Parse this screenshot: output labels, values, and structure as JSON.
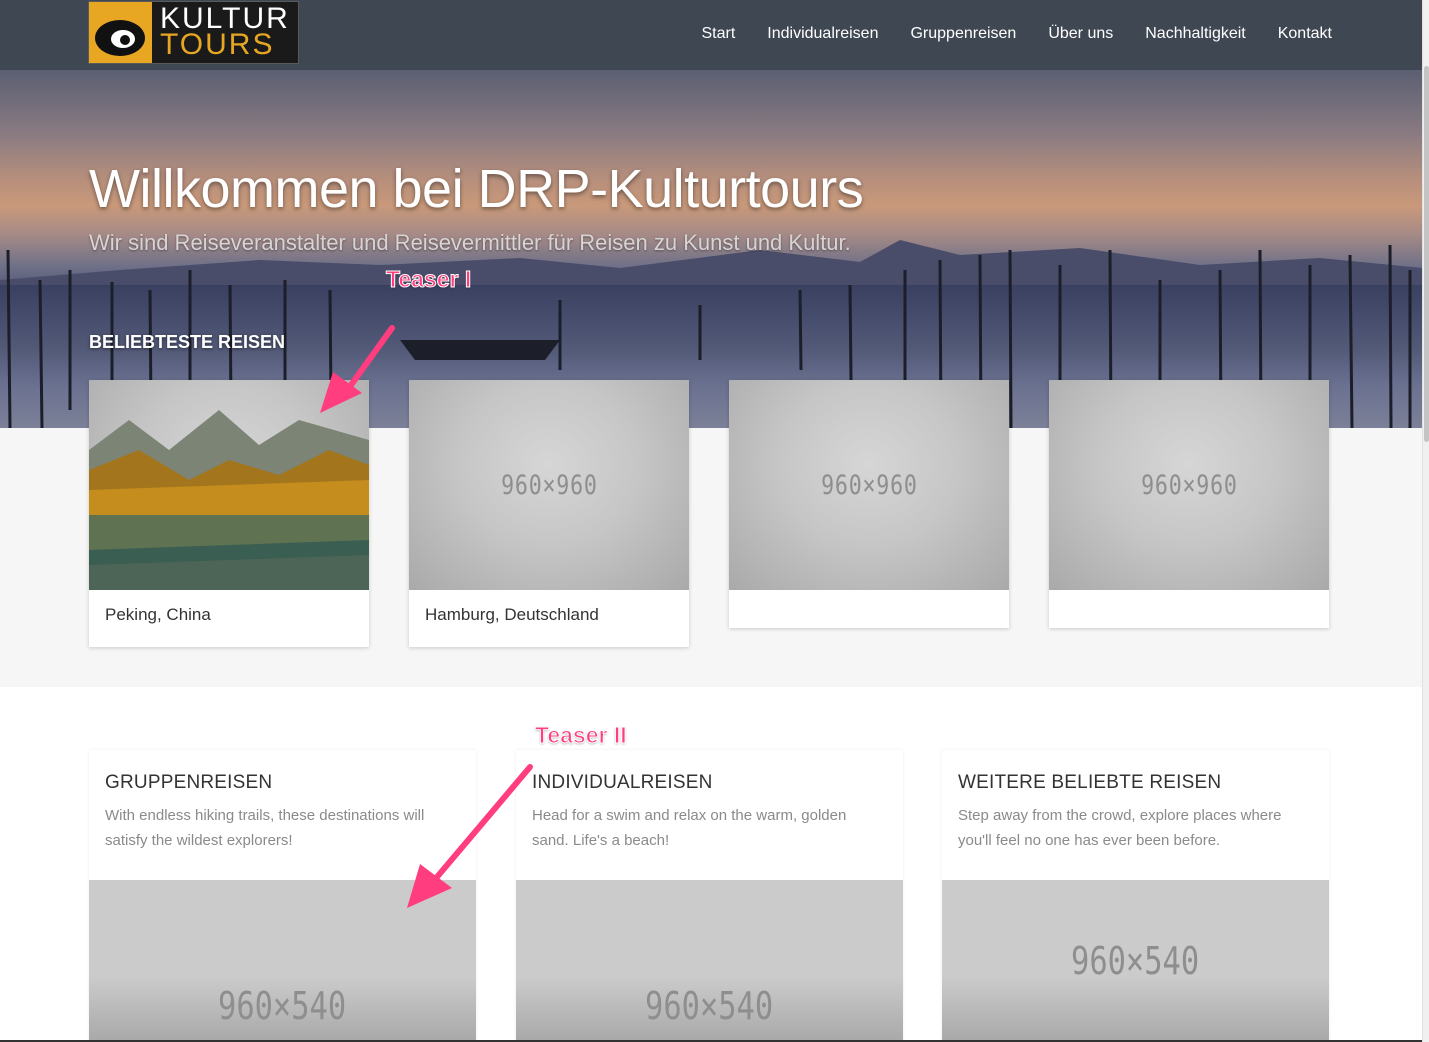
{
  "brand": {
    "line1": "KULTUR",
    "line2": "TOURS"
  },
  "nav": [
    "Start",
    "Individualreisen",
    "Gruppenreisen",
    "Über uns",
    "Nachhaltigkeit",
    "Kontakt"
  ],
  "hero": {
    "title": "Willkommen bei DRP-Kulturtours",
    "subtitle": "Wir sind Reiseveranstalter und Reisevermittler für Reisen zu Kunst und Kultur."
  },
  "popular": {
    "label": "BELIEBTESTE REISEN",
    "cards": [
      {
        "caption": "Peking, China",
        "placeholder": ""
      },
      {
        "caption": "Hamburg, Deutschland",
        "placeholder": "960×960"
      },
      {
        "caption": "",
        "placeholder": "960×960"
      },
      {
        "caption": "",
        "placeholder": "960×960"
      }
    ]
  },
  "teasers": [
    {
      "title": "GRUPPENREISEN",
      "text": "With endless hiking trails, these destinations will satisfy the wildest explorers!",
      "placeholder": "960×540"
    },
    {
      "title": "INDIVIDUALREISEN",
      "text": "Head for a swim and relax on the warm, golden sand. Life's a beach!",
      "placeholder": "960×540"
    },
    {
      "title": "WEITERE BELIEBTE REISEN",
      "text": "Step away from the crowd, explore places where you'll feel no one has ever been before.",
      "placeholder": "960×540"
    }
  ],
  "annotations": {
    "teaser1": "Teaser I",
    "teaser2": "Teaser II",
    "color": "#ff3d7f"
  },
  "colors": {
    "header": "#3f4753",
    "brand_accent": "#e7a722",
    "band": "#f5f6f5"
  }
}
